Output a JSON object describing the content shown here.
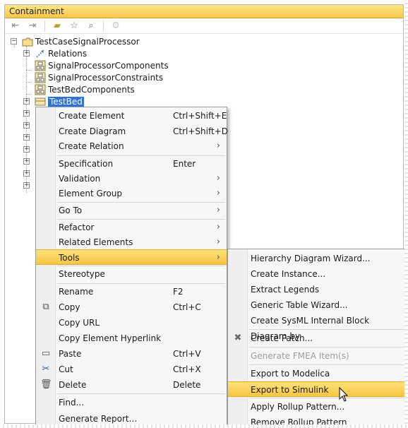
{
  "panel": {
    "title": "Containment"
  },
  "toolbar": {
    "buttons": [
      {
        "name": "collapse-all-icon",
        "glyph": "⇤"
      },
      {
        "name": "expand-all-icon",
        "glyph": "⇥"
      },
      {
        "name": "open-folder-icon",
        "glyph": "📂"
      },
      {
        "name": "star-icon",
        "glyph": "☆"
      },
      {
        "name": "search-icon",
        "glyph": "🔍"
      },
      {
        "name": "settings-icon",
        "glyph": "⚙"
      }
    ]
  },
  "tree": {
    "root": {
      "label": "TestCaseSignalProcessor"
    },
    "children": [
      {
        "label": "Relations",
        "icon": "relations-icon"
      },
      {
        "label": "SignalProcessorComponents",
        "icon": "package-icon"
      },
      {
        "label": "SignalProcessorConstraints",
        "icon": "package-icon"
      },
      {
        "label": "TestBedComponents",
        "icon": "package-icon"
      },
      {
        "label": "TestBed",
        "icon": "block-icon",
        "selected": true
      }
    ]
  },
  "context_menu": {
    "items": [
      {
        "label": "Create Element",
        "shortcut": "Ctrl+Shift+E"
      },
      {
        "label": "Create Diagram",
        "shortcut": "Ctrl+Shift+D"
      },
      {
        "label": "Create Relation",
        "submenu": true
      },
      {
        "label": "Specification",
        "shortcut": "Enter"
      },
      {
        "label": "Validation",
        "submenu": true
      },
      {
        "label": "Element Group",
        "submenu": true
      },
      {
        "label": "Go To",
        "submenu": true
      },
      {
        "label": "Refactor",
        "submenu": true
      },
      {
        "label": "Related Elements",
        "submenu": true
      },
      {
        "label": "Tools",
        "submenu": true,
        "highlighted": true
      },
      {
        "label": "Stereotype"
      },
      {
        "label": "Rename",
        "shortcut": "F2"
      },
      {
        "label": "Copy",
        "shortcut": "Ctrl+C",
        "icon": "copy-icon"
      },
      {
        "label": "Copy URL"
      },
      {
        "label": "Copy Element Hyperlink"
      },
      {
        "label": "Paste",
        "shortcut": "Ctrl+V",
        "icon": "paste-icon"
      },
      {
        "label": "Cut",
        "shortcut": "Ctrl+X",
        "icon": "cut-icon"
      },
      {
        "label": "Delete",
        "shortcut": "Delete",
        "icon": "delete-icon"
      },
      {
        "label": "Find..."
      },
      {
        "label": "Generate Report..."
      }
    ]
  },
  "tools_submenu": {
    "items": [
      {
        "label": "Hierarchy Diagram Wizard..."
      },
      {
        "label": "Create Instance..."
      },
      {
        "label": "Extract Legends"
      },
      {
        "label": "Generic Table Wizard..."
      },
      {
        "label": "Create SysML Internal Block Diagram by"
      },
      {
        "label": "Create Patch...",
        "icon": "patch-icon"
      },
      {
        "label": "Generate FMEA Item(s)",
        "disabled": true
      },
      {
        "label": "Export to Modelica"
      },
      {
        "label": "Export to Simulink",
        "highlighted": true
      },
      {
        "label": "Apply Rollup Pattern..."
      },
      {
        "label": "Remove Rollup Pattern"
      }
    ]
  },
  "colors": {
    "title_bar": "#f6c54a",
    "highlight": "#f7c542",
    "selection": "#2f73d9"
  }
}
